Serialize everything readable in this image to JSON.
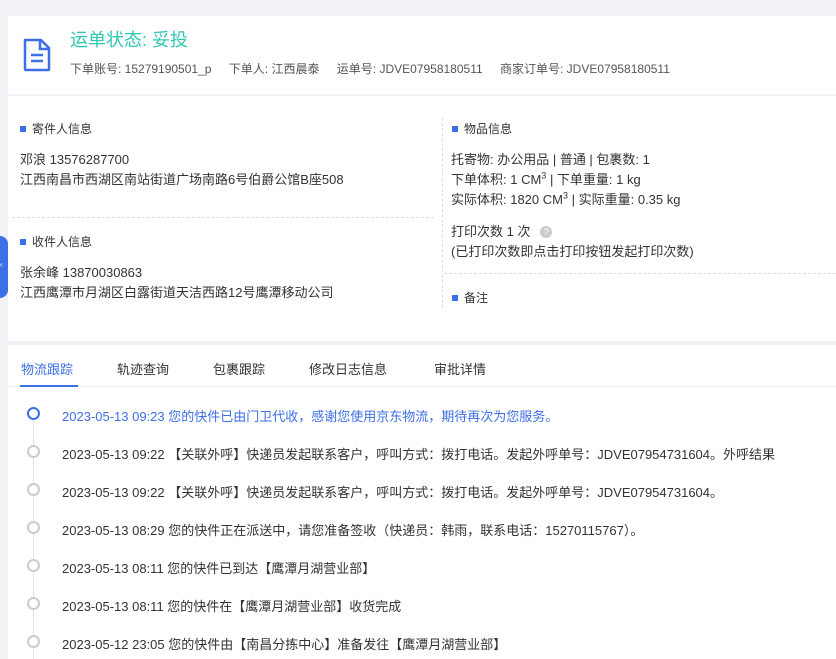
{
  "header": {
    "status_title": "运单状态: 妥投",
    "order_account": "下单账号: 15279190501_p",
    "orderer": "下单人: 江西晨泰",
    "waybill": "运单号: JDVE07958180511",
    "merchant_order": "商家订单号: JDVE07958180511",
    "icon": "document-icon"
  },
  "sender": {
    "title": "寄件人信息",
    "name_phone": "邓浪   13576287700",
    "address": "江西南昌市西湖区南站街道广场南路6号伯爵公馆B座508"
  },
  "receiver": {
    "title": "收件人信息",
    "name_phone": "张余峰   13870030863",
    "address": "江西鹰潭市月湖区白露街道天洁西路12号鹰潭移动公司"
  },
  "goods": {
    "title": "物品信息",
    "line1": "托寄物:  办公用品 | 普通  |  包裹数:  1",
    "order_volume_label": "下单体积:   1 CM",
    "order_weight": "|  下单重量:   1 kg",
    "actual_volume_label": "实际体积:    1820 CM",
    "actual_weight": "|  实际重量:  0.35 kg",
    "superscript": "3",
    "print_count": "打印次数   1 次",
    "print_note": "(已打印次数即点击打印按钮发起打印次数)",
    "help_glyph": "?"
  },
  "remark": {
    "title": "备注"
  },
  "side_tab": {
    "glyph": "‹"
  },
  "tabs": [
    {
      "label": "物流跟踪"
    },
    {
      "label": "轨迹查询"
    },
    {
      "label": "包裹跟踪"
    },
    {
      "label": "修改日志信息"
    },
    {
      "label": "审批详情"
    }
  ],
  "timeline": [
    "2023-05-13 09:23 您的快件已由门卫代收，感谢您使用京东物流，期待再次为您服务。",
    "2023-05-13 09:22 【关联外呼】快递员发起联系客户，呼叫方式：拨打电话。发起外呼单号：JDVE07954731604。外呼结果",
    "2023-05-13 09:22 【关联外呼】快递员发起联系客户，呼叫方式：拨打电话。发起外呼单号：JDVE07954731604。",
    "2023-05-13 08:29 您的快件正在派送中，请您准备签收（快递员：韩雨，联系电话：15270115767）。",
    "2023-05-13 08:11 您的快件已到达【鹰潭月湖营业部】",
    "2023-05-13 08:11 您的快件在【鹰潭月湖营业部】收货完成",
    "2023-05-12 23:05 您的快件由【南昌分拣中心】准备发往【鹰潭月湖营业部】"
  ],
  "colors": {
    "accent": "#3d6fe6",
    "status": "#2ec7b0"
  }
}
